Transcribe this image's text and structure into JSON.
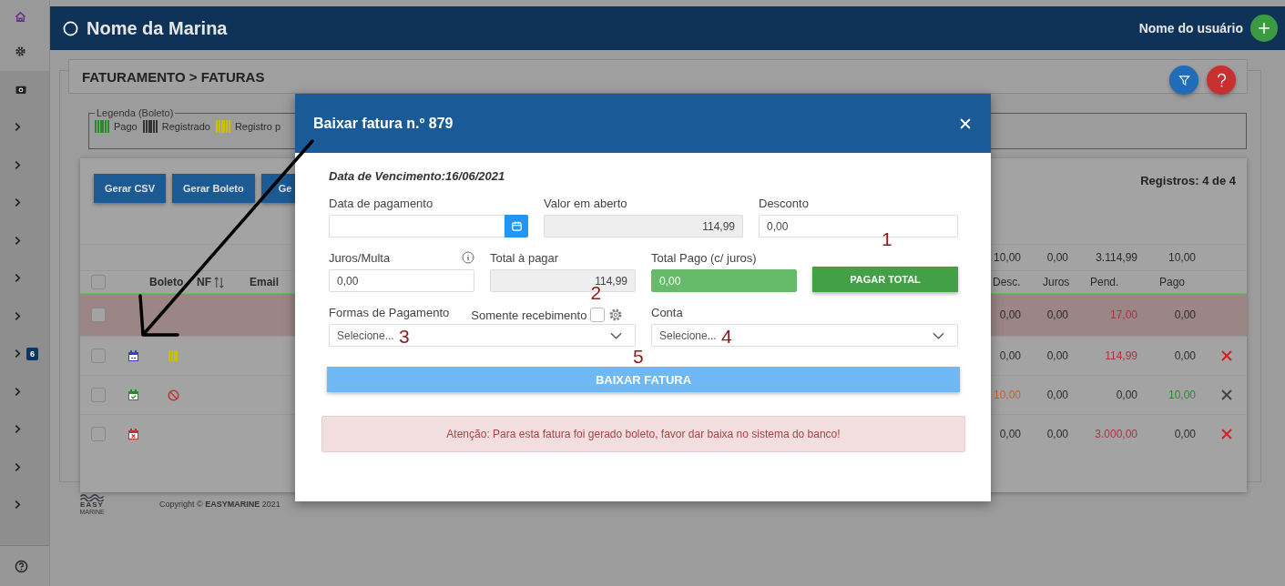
{
  "sidebar": {
    "items": [
      {
        "kind": "home"
      },
      {
        "kind": "gear"
      },
      {
        "kind": "camera"
      },
      {
        "kind": "chevron"
      },
      {
        "kind": "chevron"
      },
      {
        "kind": "chevron"
      },
      {
        "kind": "chevron"
      },
      {
        "kind": "chevron"
      },
      {
        "kind": "chevron"
      },
      {
        "kind": "chevron",
        "badge": "6"
      },
      {
        "kind": "chevron"
      },
      {
        "kind": "chevron"
      },
      {
        "kind": "chevron"
      },
      {
        "kind": "chevron"
      }
    ],
    "footer_items": [
      {
        "kind": "help"
      }
    ]
  },
  "header": {
    "title": "Nome da Marina",
    "user": "Nome do usuário"
  },
  "breadcrumb": "FATURAMENTO > FATURAS",
  "legend": {
    "title": "Legenda (Boleto)",
    "items": [
      {
        "label": "Pago",
        "color": "#2a8a2a"
      },
      {
        "label": "Registrado",
        "color": "#333333"
      },
      {
        "label": "Registro p",
        "color": "#c8c000"
      }
    ]
  },
  "toolbar": {
    "buttons": [
      "Gerar CSV",
      "Gerar Boleto",
      "Ge"
    ],
    "records": "Registros: 4 de 4"
  },
  "table": {
    "columns_left": [
      "Boleto",
      "NF",
      "Email"
    ],
    "columns_right": [
      "Desc.",
      "Juros",
      "Pend.",
      "Pago"
    ],
    "totals": [
      "10,00",
      "0,00",
      "3.114,99",
      "10,00"
    ],
    "header_checked": false,
    "rows": [
      {
        "highlighted": true,
        "checked": false,
        "icons": [],
        "values": [
          {
            "text": "0,00",
            "color": "#2a2a2a"
          },
          {
            "text": "0,00",
            "color": "#2a2a2a"
          },
          {
            "text": "17,00",
            "color": "#b03040"
          },
          {
            "text": "0,00",
            "color": "#2a2a2a"
          }
        ]
      },
      {
        "highlighted": false,
        "checked": false,
        "icons": [
          {
            "kind": "calendar",
            "color": "#3a3ad0"
          },
          {
            "kind": "barcode",
            "color": "#c8c000"
          }
        ],
        "delete": {
          "color": "#d42020"
        },
        "values": [
          {
            "text": "0,00",
            "color": "#2a2a2a"
          },
          {
            "text": "0,00",
            "color": "#2a2a2a"
          },
          {
            "text": "114,99",
            "color": "#b03040"
          },
          {
            "text": "0,00",
            "color": "#2a2a2a"
          }
        ]
      },
      {
        "highlighted": false,
        "checked": false,
        "icons": [
          {
            "kind": "calendar_check",
            "color": "#2a8a2a"
          },
          {
            "kind": "prohibited",
            "color": "#c83030"
          }
        ],
        "delete": {
          "color": "#444444"
        },
        "values": [
          {
            "text": "10,00",
            "color": "#c86030"
          },
          {
            "text": "0,00",
            "color": "#2a2a2a"
          },
          {
            "text": "0,00",
            "color": "#2a2a2a"
          },
          {
            "text": "10,00",
            "color": "#2a8a2a"
          }
        ]
      },
      {
        "highlighted": false,
        "checked": false,
        "icons": [
          {
            "kind": "calendar_x",
            "color": "#c83030"
          }
        ],
        "delete": {
          "color": "#d42020"
        },
        "values": [
          {
            "text": "0,00",
            "color": "#2a2a2a"
          },
          {
            "text": "0,00",
            "color": "#2a2a2a"
          },
          {
            "text": "3.000,00",
            "color": "#b03040"
          },
          {
            "text": "0,00",
            "color": "#2a2a2a"
          }
        ]
      }
    ]
  },
  "modal": {
    "title": "Baixar fatura n.º 879",
    "due_date": "Data de Vencimento:16/06/2021",
    "row_1": [
      {
        "kind": "date",
        "label": "Data de pagamento"
      },
      {
        "kind": "readonly",
        "label": "Valor em aberto",
        "value": "114,99"
      },
      {
        "kind": "text",
        "label": "Desconto",
        "value": "0,00"
      }
    ],
    "row_2": [
      {
        "kind": "text",
        "label": "Juros/Multa",
        "value": "0,00",
        "info": true
      },
      {
        "kind": "readonly",
        "label": "Total à pagar",
        "value": "114,99"
      },
      {
        "kind": "highlight",
        "label": "Total Pago (c/ juros)",
        "value": "0,00"
      },
      {
        "kind": "button",
        "label": "PAGAR TOTAL",
        "annotation": "1"
      }
    ],
    "row_3": [
      {
        "kind": "select",
        "label": "Formas de Pagamento",
        "placeholder": "Selecione...",
        "annotation": "3",
        "checkbox": {
          "label": "Somente recebimento",
          "checked": false,
          "annotation": "2"
        }
      },
      {
        "kind": "select",
        "label": "Conta",
        "placeholder": "Selecione...",
        "annotation": "4"
      }
    ],
    "submit": {
      "label": "BAIXAR FATURA",
      "annotation": "5"
    },
    "alert": "Atenção: Para esta fatura foi gerado boleto, favor dar baixa no sistema do banco!"
  },
  "footer": {
    "logo_top": "EASY",
    "logo_bottom": "MARINE",
    "copyright": "Copyright © **EASYMARINE** 2021"
  }
}
